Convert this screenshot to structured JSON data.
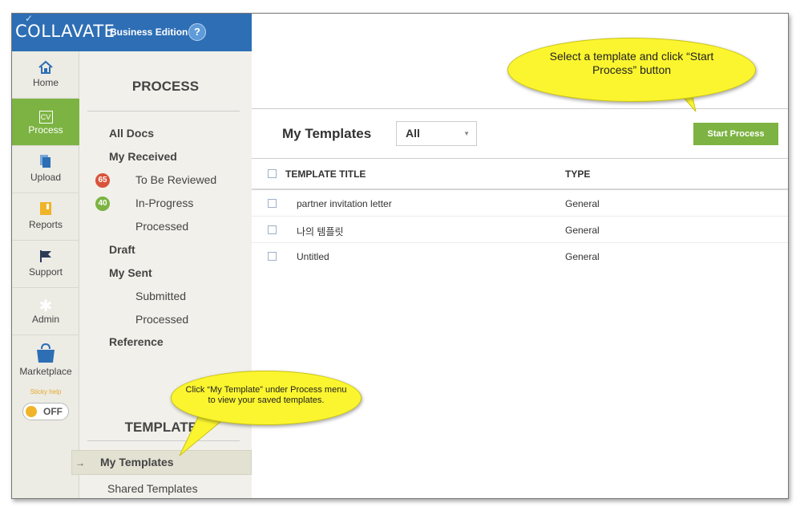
{
  "brand": {
    "logo": "COLLAVATE",
    "edition": "Business Edition",
    "help": "?"
  },
  "icon_nav": {
    "items": [
      {
        "label": "Home",
        "icon": "home-icon"
      },
      {
        "label": "Process",
        "icon": "cv-icon",
        "icon_text": "CV",
        "active": true
      },
      {
        "label": "Upload",
        "icon": "upload-icon"
      },
      {
        "label": "Reports",
        "icon": "reports-icon"
      },
      {
        "label": "Support",
        "icon": "flag-icon"
      },
      {
        "label": "Admin",
        "icon": "gear-icon"
      },
      {
        "label": "Marketplace",
        "icon": "marketplace-bag-icon"
      }
    ],
    "sticky_help": {
      "label": "Sticky help",
      "state": "OFF"
    }
  },
  "process_menu": {
    "heading": "PROCESS",
    "all_docs": "All Docs",
    "my_received": "My Received",
    "to_be_reviewed": {
      "label": "To Be Reviewed",
      "count": "65"
    },
    "in_progress": {
      "label": "In-Progress",
      "count": "40"
    },
    "received_processed": "Processed",
    "draft": "Draft",
    "my_sent": "My Sent",
    "submitted": "Submitted",
    "sent_processed": "Processed",
    "reference": "Reference",
    "templates_heading": "TEMPLATES",
    "my_templates": "My Templates",
    "shared_templates": "Shared Templates",
    "active_arrow": "→"
  },
  "main": {
    "title": "My Templates",
    "filter": {
      "value": "All",
      "caret": "▼"
    },
    "start_button": "Start Process",
    "columns": {
      "title": "TEMPLATE TITLE",
      "type": "TYPE"
    },
    "rows": [
      {
        "title": "partner invitation letter",
        "type": "General"
      },
      {
        "title": "나의 템플릿",
        "type": "General"
      },
      {
        "title": "Untitled",
        "type": "General"
      }
    ]
  },
  "callouts": {
    "top": "Select a template and click “Start Process” button",
    "bottom": "Click “My Template” under Process menu to view your saved templates."
  },
  "colors": {
    "brand_blue": "#2d6eb5",
    "accent_green": "#7cb342",
    "badge_red": "#d9533b",
    "callout_yellow": "#fbf52f"
  }
}
